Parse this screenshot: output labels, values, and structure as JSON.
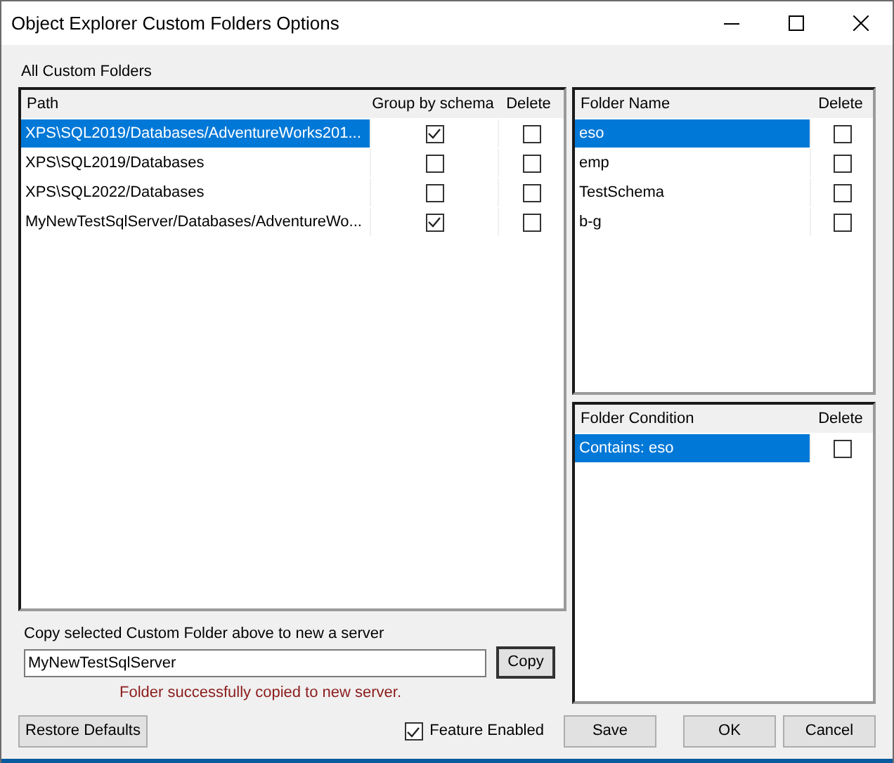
{
  "window": {
    "title": "Object Explorer Custom Folders Options"
  },
  "group_label": "All Custom Folders",
  "folders_table": {
    "columns": [
      "Path",
      "Group by schema",
      "Delete"
    ],
    "rows": [
      {
        "path": "XPS\\SQL2019/Databases/AdventureWorks201...",
        "group_by_schema": true,
        "delete": false,
        "selected": true
      },
      {
        "path": "XPS\\SQL2019/Databases",
        "group_by_schema": false,
        "delete": false,
        "selected": false
      },
      {
        "path": "XPS\\SQL2022/Databases",
        "group_by_schema": false,
        "delete": false,
        "selected": false
      },
      {
        "path": "MyNewTestSqlServer/Databases/AdventureWo...",
        "group_by_schema": true,
        "delete": false,
        "selected": false
      }
    ]
  },
  "names_table": {
    "columns": [
      "Folder Name",
      "Delete"
    ],
    "rows": [
      {
        "name": "eso",
        "delete": false,
        "selected": true
      },
      {
        "name": "emp",
        "delete": false,
        "selected": false
      },
      {
        "name": "TestSchema",
        "delete": false,
        "selected": false
      },
      {
        "name": "b-g",
        "delete": false,
        "selected": false
      }
    ]
  },
  "conditions_table": {
    "columns": [
      "Folder Condition",
      "Delete"
    ],
    "rows": [
      {
        "condition": "Contains: eso",
        "delete": false,
        "selected": true
      }
    ]
  },
  "copy": {
    "label": "Copy selected Custom Folder above to new a server",
    "value": "MyNewTestSqlServer",
    "button": "Copy",
    "message": "Folder successfully copied to new server."
  },
  "restore_button": "Restore Defaults",
  "feature_enabled": {
    "label": "Feature Enabled",
    "checked": true
  },
  "buttons": [
    "Save",
    "OK",
    "Cancel"
  ]
}
